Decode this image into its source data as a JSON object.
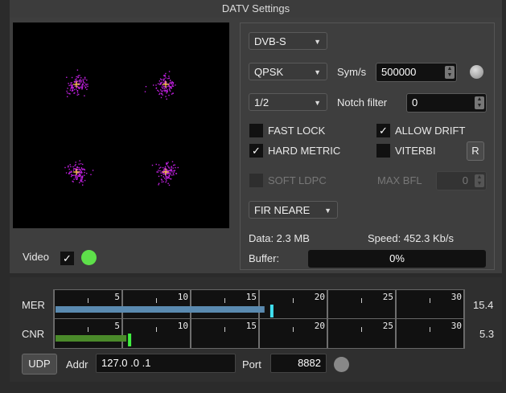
{
  "window": {
    "title": "DATV Settings"
  },
  "scope": {
    "constellation": "QPSK",
    "point_color": "#c020e0",
    "center_color": "#ffd040"
  },
  "video": {
    "label": "Video",
    "checked": "✓",
    "led_color": "#5ee04a"
  },
  "standard": {
    "value": "DVB-S"
  },
  "modulation": {
    "value": "QPSK"
  },
  "symrate": {
    "label": "Sym/s",
    "value": "500000"
  },
  "fec": {
    "value": "1/2"
  },
  "notch": {
    "label": "Notch filter",
    "value": "0"
  },
  "options": {
    "fast_lock": {
      "label": "FAST LOCK",
      "mark": ""
    },
    "allow_drift": {
      "label": "ALLOW DRIFT",
      "mark": "✓"
    },
    "hard_metric": {
      "label": "HARD METRIC",
      "mark": "✓"
    },
    "viterbi": {
      "label": "VITERBI",
      "mark": ""
    },
    "soft_ldpc": {
      "label": "SOFT LDPC",
      "mark": ""
    }
  },
  "reset_button": {
    "label": "R"
  },
  "max_bfl": {
    "label": "MAX BFL",
    "value": "0"
  },
  "filter": {
    "value": "FIR NEARE"
  },
  "stats": {
    "data": "Data: 2.3 MB",
    "speed": "Speed: 452.3 Kb/s"
  },
  "buffer": {
    "label": "Buffer:",
    "value": "0%",
    "level": 0
  },
  "mer": {
    "label": "MER",
    "value": "15.4",
    "level": 15.4,
    "peak": 15.7,
    "bar_color": "#5a8ab0",
    "peak_color": "#40e0f0"
  },
  "cnr": {
    "label": "CNR",
    "value": "5.3",
    "level": 5.3,
    "peak": 5.3,
    "bar_color": "#4a8a2a",
    "peak_color": "#40f040"
  },
  "scale": {
    "ticks": [
      "5",
      "10",
      "15",
      "20",
      "25",
      "30"
    ],
    "max": 30
  },
  "udp": {
    "button": "UDP",
    "addr_label": "Addr",
    "addr_value": "127.0 .0 .1",
    "port_label": "Port",
    "port_value": "8882",
    "led_color": "#888888"
  }
}
